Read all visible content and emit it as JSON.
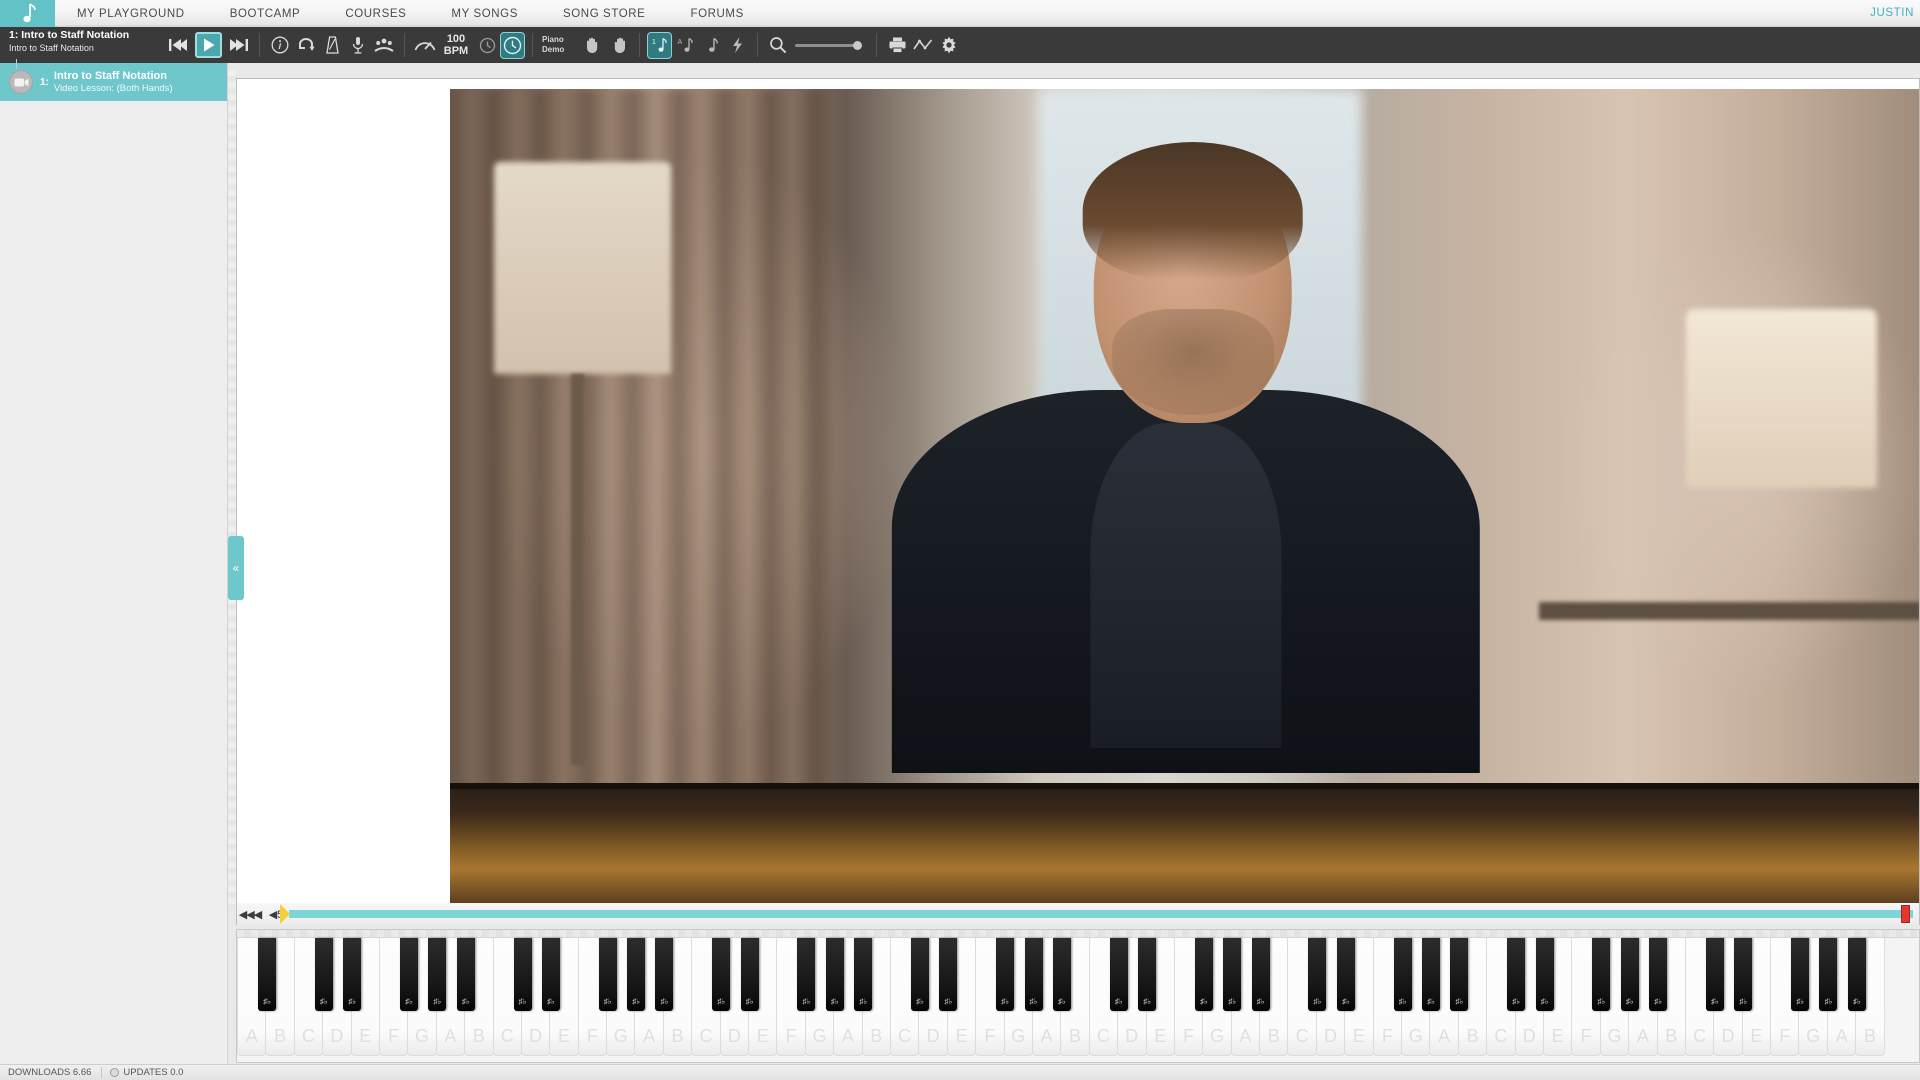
{
  "top_nav": {
    "logo_name": "piano-note-logo",
    "tabs": [
      {
        "label": "MY PLAYGROUND"
      },
      {
        "label": "BOOTCAMP"
      },
      {
        "label": "COURSES"
      },
      {
        "label": "MY SONGS"
      },
      {
        "label": "SONG STORE"
      },
      {
        "label": "FORUMS"
      }
    ],
    "user": "JUSTIN",
    "accent_color": "#62c2c6"
  },
  "toolbar": {
    "lesson_title": "1: Intro to Staff Notation",
    "lesson_subtitle": "Intro to Staff Notation",
    "rewind_label": "rewind",
    "play_label": "play",
    "forward_label": "forward",
    "info_label": "info",
    "loop_label": "loop",
    "metronome_label": "metronome",
    "mic_label": "microphone",
    "people_label": "community",
    "tempo_label": "tempo",
    "bpm_value": "100",
    "bpm_unit": "BPM",
    "clock_half_label": "half time",
    "clock_full_label": "full time",
    "piano_demo_line1": "Piano",
    "piano_demo_line2": "Demo",
    "left_hand_label": "left hand",
    "right_hand_label": "right hand",
    "note1_label": "note-one",
    "noteA_label": "note-a",
    "note_label": "note",
    "bolt_label": "lightning",
    "zoom_label": "zoom",
    "print_label": "print",
    "stats_label": "statistics",
    "settings_label": "settings",
    "background": "#3a3a3a",
    "active_color": "#2f7b81",
    "play_color": "#4aa7ae"
  },
  "sidebar": {
    "lesson": {
      "number": "1:",
      "title": "Intro to Staff Notation",
      "subtitle": "Video Lesson: (Both Hands)",
      "badge": "video-camera",
      "highlight_color": "#6ec7cb"
    }
  },
  "collapse": {
    "glyph": "«"
  },
  "timeline": {
    "rewind_all_glyph": "◀◀◀",
    "rewind_step_glyph": "◀5",
    "progress_color": "#7fd4d8",
    "playhead_left_color": "#f3d03a",
    "playhead_right_color": "#e8352e"
  },
  "keyboard": {
    "white_note_labels": [
      "A",
      "B",
      "C",
      "D",
      "E",
      "F",
      "G",
      "A",
      "B",
      "C",
      "D",
      "E",
      "F",
      "G",
      "A",
      "B",
      "C",
      "D",
      "E",
      "F",
      "G",
      "A",
      "B",
      "C",
      "D",
      "E",
      "F",
      "G",
      "A",
      "B",
      "C",
      "D",
      "E",
      "F",
      "G",
      "A",
      "B",
      "C",
      "D",
      "E",
      "F",
      "G",
      "A",
      "B",
      "C",
      "D",
      "E",
      "F",
      "G",
      "A",
      "B",
      "C",
      "D",
      "E",
      "F",
      "G",
      "A",
      "B"
    ],
    "black_key_label": "♯♭"
  },
  "status_bar": {
    "downloads": "DOWNLOADS 6.66",
    "updates": "UPDATES 0.0"
  }
}
